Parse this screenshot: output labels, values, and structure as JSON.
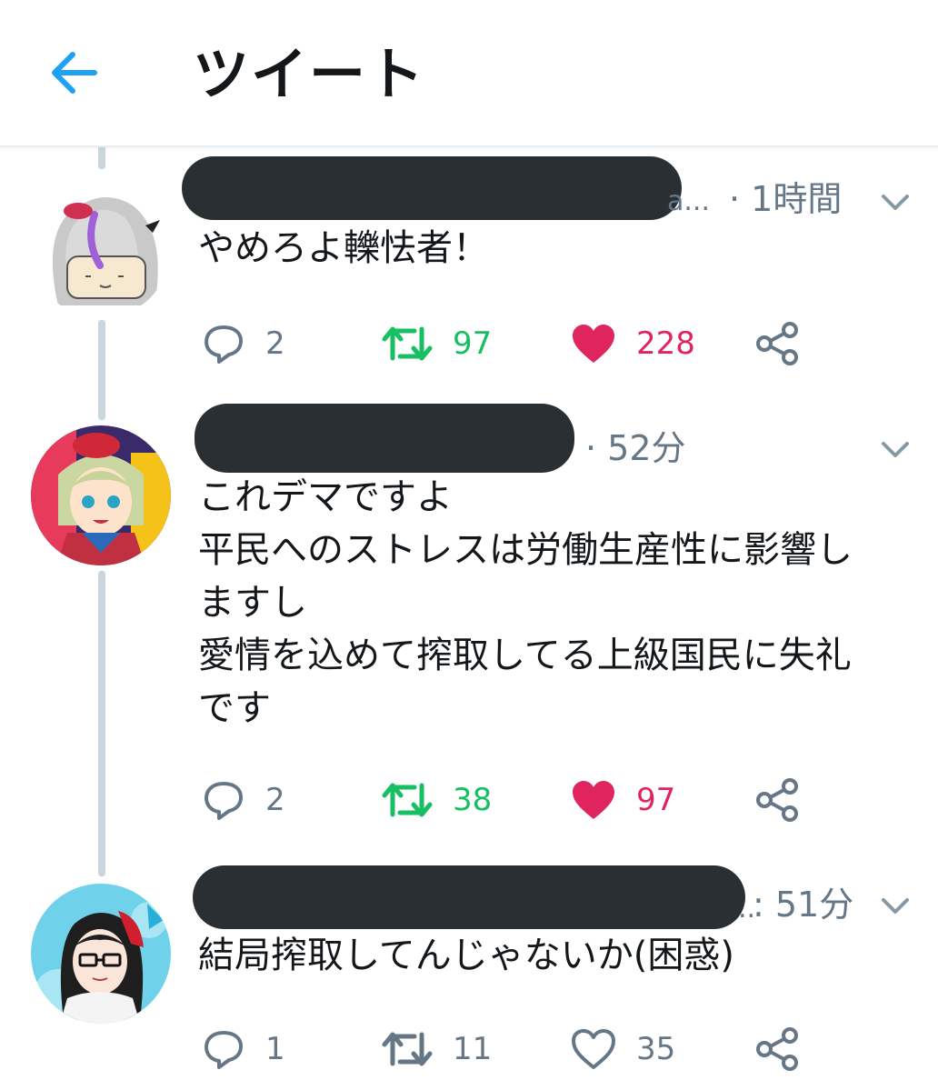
{
  "header": {
    "title": "ツイート",
    "back_icon": "arrow-left-icon"
  },
  "colors": {
    "accent": "#1da1f2",
    "retweet": "#17bf63",
    "like": "#e0245e",
    "muted": "#657786",
    "thread_line": "#ccd6dd"
  },
  "tweets": [
    {
      "handle_tail": "a...",
      "time": "· 1時間",
      "text": "やめろよ轢怯者！",
      "replies": "2",
      "retweets": "97",
      "likes": "228",
      "liked": true,
      "retweeted": true
    },
    {
      "handle_tail": "",
      "time": "· 52分",
      "text": "これデマですよ\n平民へのストレスは労働生産性に影響し\nますし\n愛情を込めて搾取してる上級国民に失礼\nです",
      "replies": "2",
      "retweets": "38",
      "likes": "97",
      "liked": true,
      "retweeted": true
    },
    {
      "handle_tail": "..",
      "time": ": 51分",
      "text": "結局搾取してんじゃないか(困惑)",
      "replies": "1",
      "retweets": "11",
      "likes": "35",
      "liked": false,
      "retweeted": false
    }
  ]
}
